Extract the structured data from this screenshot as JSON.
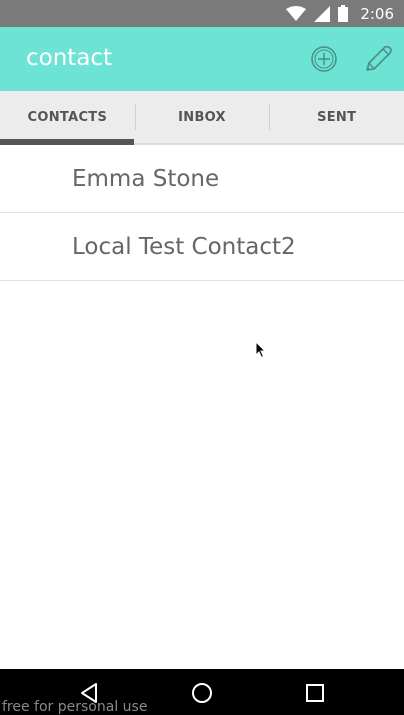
{
  "status_bar": {
    "time": "2:06",
    "icons": [
      "wifi-icon",
      "signal-icon",
      "battery-icon"
    ]
  },
  "app_bar": {
    "title": "contact",
    "actions": [
      "add-circle-icon",
      "pencil-icon"
    ],
    "background_color": "#6ce3d4"
  },
  "tabs": {
    "items": [
      {
        "label": "CONTACTS",
        "selected": true
      },
      {
        "label": "INBOX",
        "selected": false
      },
      {
        "label": "SENT",
        "selected": false
      }
    ],
    "indicator_color": "#555555"
  },
  "contacts": {
    "items": [
      {
        "name": "Emma Stone"
      },
      {
        "name": "Local Test Contact2"
      }
    ]
  },
  "nav_bar": {
    "buttons": [
      "back-triangle-icon",
      "home-circle-icon",
      "recents-square-icon"
    ]
  },
  "watermark": "free for personal use"
}
